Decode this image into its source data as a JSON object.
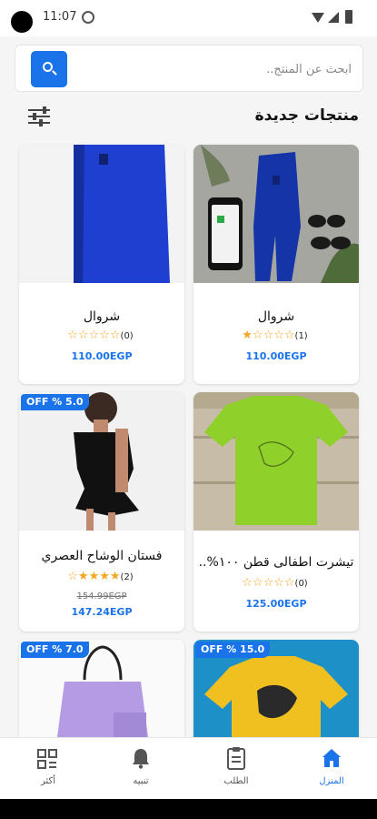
{
  "status_bar": {
    "time": "11:07"
  },
  "search": {
    "placeholder": "ابحث عن المنتج..",
    "value": ""
  },
  "section": {
    "title": "منتجات جديدة"
  },
  "products": [
    {
      "name": "شروال",
      "rating": 1,
      "reviews": "(1)",
      "price": "110.00EGP",
      "old_price": "",
      "discount": ""
    },
    {
      "name": "شروال",
      "rating": 0,
      "reviews": "(0)",
      "price": "110.00EGP",
      "old_price": "",
      "discount": ""
    },
    {
      "name": "تيشرت اطفالى قطن ١٠٠%..",
      "rating": 0,
      "reviews": "(0)",
      "price": "125.00EGP",
      "old_price": "",
      "discount": ""
    },
    {
      "name": "فستان الوشاح العصري",
      "rating": 4,
      "reviews": "(2)",
      "price": "147.24EGP",
      "old_price": "154.99EGP",
      "discount": "OFF % 5.0"
    },
    {
      "name": "",
      "rating": 0,
      "reviews": "",
      "price": "",
      "old_price": "",
      "discount": "OFF % 15.0"
    },
    {
      "name": "",
      "rating": 0,
      "reviews": "",
      "price": "",
      "old_price": "",
      "discount": "OFF % 7.0"
    }
  ],
  "nav": {
    "home": "المنزل",
    "orders": "الطلب",
    "notifications": "تنبيه",
    "more": "أكثر"
  },
  "colors": {
    "accent": "#1a73e8",
    "star": "#f5a623"
  }
}
